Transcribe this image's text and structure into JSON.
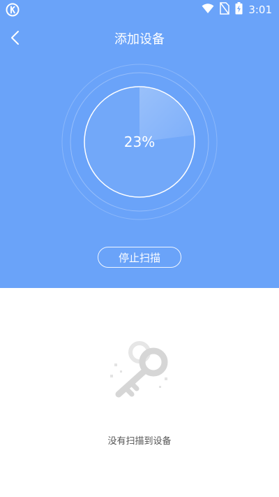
{
  "status_bar": {
    "time": "3:01",
    "icons": [
      "app-logo-icon",
      "wifi-icon",
      "no-sim-icon",
      "battery-charging-icon"
    ]
  },
  "header": {
    "title": "添加设备",
    "back_icon": "chevron-left-icon"
  },
  "scan": {
    "progress_text": "23%",
    "progress_value": 0.23,
    "stop_label": "停止扫描"
  },
  "empty_state": {
    "icon": "keys-icon",
    "message": "没有扫描到设备"
  },
  "colors": {
    "primary": "#6aa3f9",
    "background": "#ffffff",
    "text_muted": "#555555",
    "illustration": "#d9d9d9"
  }
}
